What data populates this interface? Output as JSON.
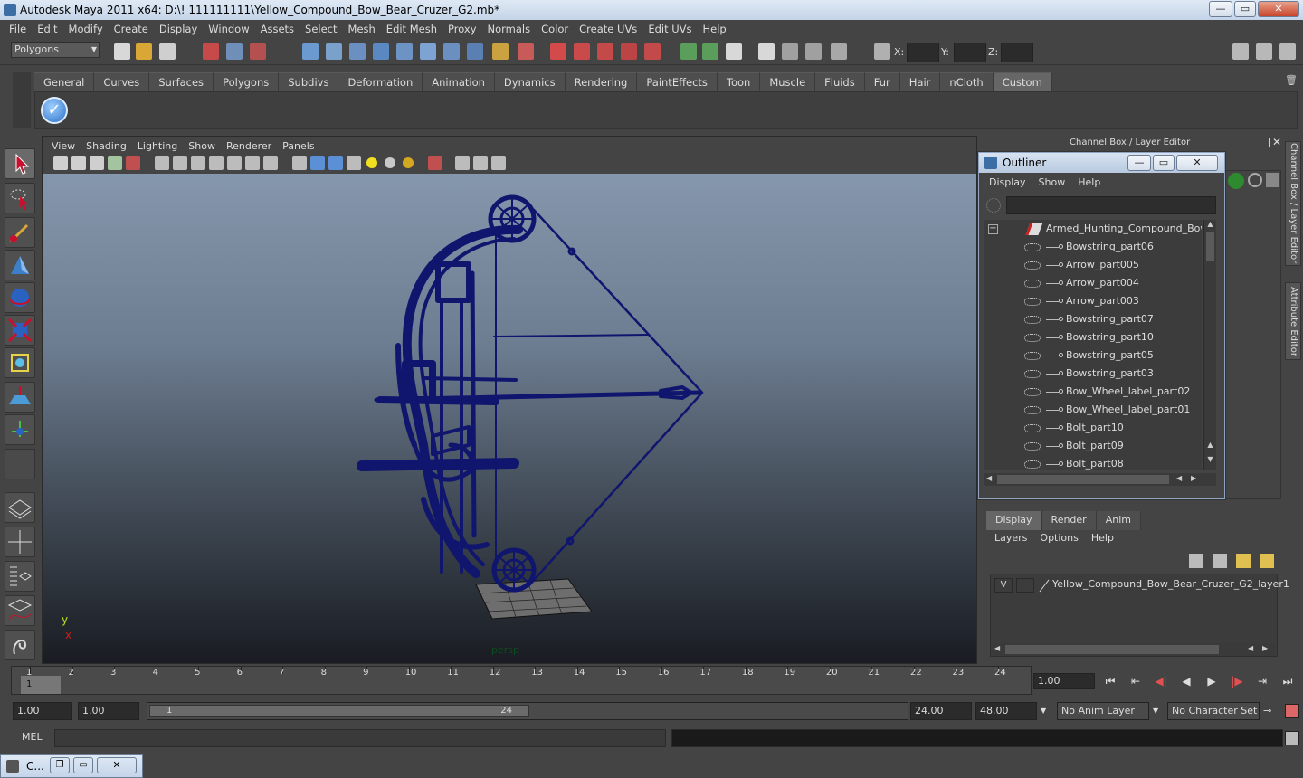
{
  "window": {
    "title": "Autodesk Maya 2011 x64: D:\\! 111111111\\Yellow_Compound_Bow_Bear_Cruzer_G2.mb*",
    "minimize": "—",
    "maximize": "▭",
    "close": "✕"
  },
  "menubar": [
    "File",
    "Edit",
    "Modify",
    "Create",
    "Display",
    "Window",
    "Assets",
    "Select",
    "Mesh",
    "Edit Mesh",
    "Proxy",
    "Normals",
    "Color",
    "Create UVs",
    "Edit UVs",
    "Help"
  ],
  "statusline": {
    "mode": "Polygons",
    "x_label": "X:",
    "y_label": "Y:",
    "z_label": "Z:"
  },
  "shelf": {
    "tabs": [
      "General",
      "Curves",
      "Surfaces",
      "Polygons",
      "Subdivs",
      "Deformation",
      "Animation",
      "Dynamics",
      "Rendering",
      "PaintEffects",
      "Toon",
      "Muscle",
      "Fluids",
      "Fur",
      "Hair",
      "nCloth",
      "Custom"
    ],
    "active": "Custom"
  },
  "viewport": {
    "menu": [
      "View",
      "Shading",
      "Lighting",
      "Show",
      "Renderer",
      "Panels"
    ],
    "camera_label": "persp",
    "axis_y": "y",
    "axis_x": "x",
    "wire_color": "#10156e"
  },
  "outliner": {
    "title": "Outliner",
    "minimize": "—",
    "maximize": "▭",
    "close": "✕",
    "menu": [
      "Display",
      "Show",
      "Help"
    ],
    "root": "Armed_Hunting_Compound_Bow_B",
    "items": [
      "Bowstring_part06",
      "Arrow_part005",
      "Arrow_part004",
      "Arrow_part003",
      "Bowstring_part07",
      "Bowstring_part10",
      "Bowstring_part05",
      "Bowstring_part03",
      "Bow_Wheel_label_part02",
      "Bow_Wheel_label_part01",
      "Bolt_part10",
      "Bolt_part09",
      "Bolt_part08"
    ]
  },
  "channelbox": {
    "title": "Channel Box / Layer Editor",
    "side_tab_1": "Channel Box / Layer Editor",
    "side_tab_2": "Attribute Editor"
  },
  "layers": {
    "tabs": [
      "Display",
      "Render",
      "Anim"
    ],
    "active": "Display",
    "menu": [
      "Layers",
      "Options",
      "Help"
    ],
    "visibility": "V",
    "layer_name": "Yellow_Compound_Bow_Bear_Cruzer_G2_layer1"
  },
  "timeslider": {
    "ticks": [
      "1",
      "2",
      "3",
      "4",
      "5",
      "6",
      "7",
      "8",
      "9",
      "10",
      "11",
      "12",
      "13",
      "14",
      "15",
      "16",
      "17",
      "18",
      "19",
      "20",
      "21",
      "22",
      "23",
      "24"
    ],
    "current_marker": "1",
    "current_frame": "1.00"
  },
  "playback": {
    "go_start": "⏮",
    "step_back_key": "⇤",
    "step_back": "◀|",
    "play_back": "◀",
    "play_forward": "▶",
    "step_forward": "|▶",
    "step_forward_key": "⇥",
    "go_end": "⏭"
  },
  "range": {
    "start": "1.00",
    "anim_start": "1.00",
    "handle_start": "1",
    "handle_end": "24",
    "end": "24.00",
    "anim_end": "48.00",
    "anim_layer": "No Anim Layer",
    "character_set": "No Character Set"
  },
  "commandline": {
    "label": "MEL"
  },
  "minimized_window": {
    "title": "C..."
  }
}
